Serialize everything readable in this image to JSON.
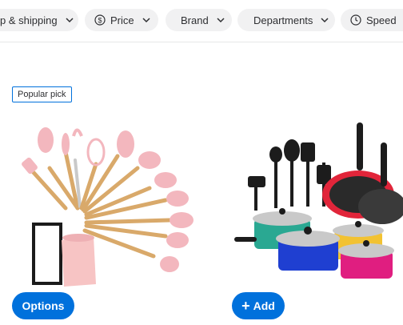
{
  "filters": {
    "chip1_label": "p & shipping",
    "chip2_label": "Price",
    "chip3_label": "Brand",
    "chip4_label": "Departments",
    "chip5_label": "Speed"
  },
  "product1": {
    "badge": "Popular pick",
    "button_label": "Options"
  },
  "product2": {
    "button_label": "Add",
    "button_icon": "+"
  },
  "colors": {
    "accent": "#0071dc",
    "chip_bg": "#f1f1f2"
  }
}
